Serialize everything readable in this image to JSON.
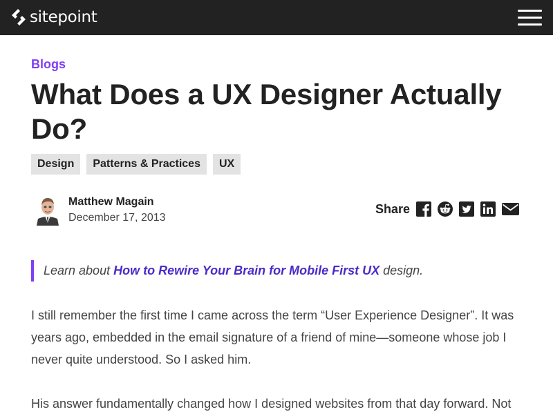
{
  "header": {
    "logo_text": "sitepoint",
    "menu_icon": "hamburger-menu-icon",
    "background": "#222222"
  },
  "article": {
    "category": "Blogs",
    "title": "What Does a UX Designer Actually Do?",
    "tags": [
      "Design",
      "Patterns & Practices",
      "UX"
    ],
    "author": {
      "name": "Matthew Magain",
      "date": "December 17, 2013"
    },
    "share": {
      "label": "Share",
      "icons": [
        "facebook-icon",
        "reddit-icon",
        "twitter-icon",
        "linkedin-icon",
        "email-icon"
      ]
    },
    "callout": {
      "before": "Learn about",
      "link": "How to Rewire Your Brain for Mobile First UX",
      "after": "design."
    },
    "paragraphs": [
      "I still remember the first time I came across the term “User Experience Designer”. It was years ago, embedded in the email signature of a friend of mine—someone whose job I never quite understood. So I asked him.",
      "His answer fundamentally changed how I designed websites from that day forward. Not"
    ]
  },
  "colors": {
    "accent": "#7f3ff2",
    "link": "#4b2ac7",
    "tag_background": "#e3e3e3"
  }
}
